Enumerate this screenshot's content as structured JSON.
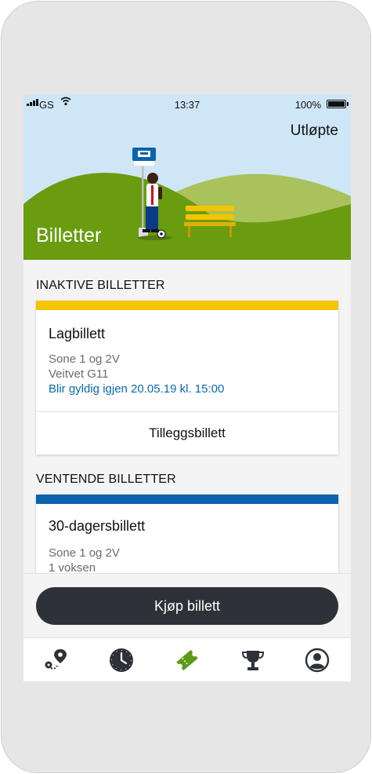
{
  "status_bar": {
    "carrier": "GS",
    "time": "13:37",
    "battery": "100%"
  },
  "header": {
    "expired_link": "Utløpte",
    "title": "Billetter"
  },
  "sections": [
    {
      "label": "INAKTIVE BILLETTER",
      "accent": "#f5c400",
      "ticket": {
        "name": "Lagbillett",
        "lines": [
          "Sone 1 og 2V",
          "Veitvet G11"
        ],
        "highlight": "Blir gyldig igjen 20.05.19 kl. 15:00",
        "action": "Tilleggsbillett"
      }
    },
    {
      "label": "VENTENDE BILLETTER",
      "accent": "#0b62ad",
      "ticket": {
        "name": "30-dagersbillett",
        "lines": [
          "Sone 1 og 2V",
          "1 voksen"
        ]
      }
    }
  ],
  "buy_button": {
    "label": "Kjøp billett"
  },
  "tabs": [
    {
      "icon": "route-pin-icon",
      "active": false
    },
    {
      "icon": "clock-icon",
      "active": false
    },
    {
      "icon": "ticket-icon",
      "active": true
    },
    {
      "icon": "trophy-icon",
      "active": false
    },
    {
      "icon": "profile-icon",
      "active": false
    }
  ],
  "colors": {
    "sky": "#cfe6f7",
    "hill_dark": "#6a9c10",
    "hill_light": "#7fab1d",
    "active_tab": "#5c9a18",
    "button": "#2e3138",
    "link_blue": "#0b6aad"
  }
}
